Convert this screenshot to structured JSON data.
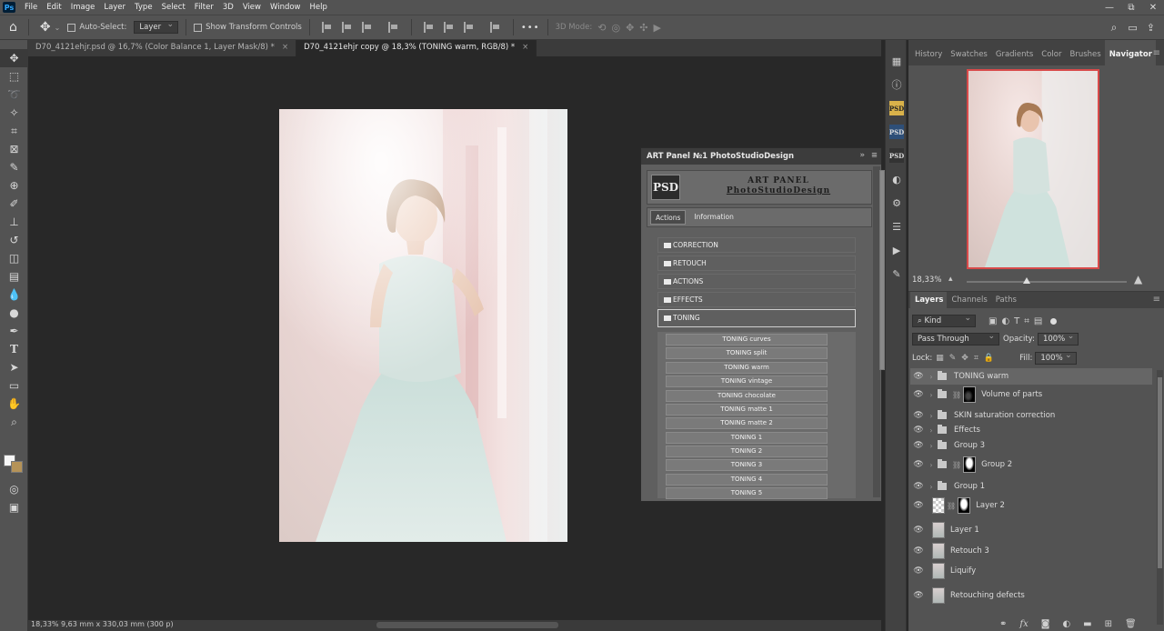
{
  "menubar": {
    "logo": "Ps",
    "items": [
      "File",
      "Edit",
      "Image",
      "Layer",
      "Type",
      "Select",
      "Filter",
      "3D",
      "View",
      "Window",
      "Help"
    ],
    "window_controls": [
      "—",
      "⧉",
      "✕"
    ]
  },
  "options": {
    "auto_select_label": "Auto-Select:",
    "auto_select_value": "Layer",
    "show_transform_label": "Show Transform Controls",
    "mode_3d_label": "3D Mode:",
    "more": "•••"
  },
  "tabs": [
    {
      "label": "D70_4121ehjr.psd @ 16,7% (Color Balance 1, Layer Mask/8) *",
      "active": false
    },
    {
      "label": "D70_4121ehjr copy @ 18,3% (TONING  warm, RGB/8) *",
      "active": true
    }
  ],
  "status": {
    "text": "18,33%  9,63 mm x 330,03 mm (300 p)"
  },
  "art_panel": {
    "title": "ART Panel №1 PhotoStudioDesign",
    "logo": "PSD",
    "brand_line1": "ART PANEL",
    "brand_line2": "PhotoStudioDesign",
    "tabs": [
      "Actions",
      "Information"
    ],
    "folders": [
      "CORRECTION",
      "RETOUCH",
      "ACTIONS",
      "EFFECTS",
      "TONING"
    ],
    "toning_buttons": [
      "TONING curves",
      "TONING split",
      "TONING warm",
      "TONING vintage",
      "TONING chocolate",
      "TONING matte 1",
      "TONING matte 2",
      "TONING 1",
      "TONING 2",
      "TONING 3",
      "TONING 4",
      "TONING 5"
    ]
  },
  "right_icons": [
    "histogram-icon",
    "info-icon",
    "psd-plugin-1",
    "psd-plugin-2",
    "psd-plugin-3",
    "adjust-icon",
    "properties-icon",
    "libraries-icon",
    "play-actions-icon",
    "brush-settings-icon"
  ],
  "navigator": {
    "tabs": [
      "History",
      "Swatches",
      "Gradients",
      "Color",
      "Brushes",
      "Navigator"
    ],
    "active_tab": "Navigator",
    "zoom": "18,33%",
    "zoom_fraction": 0.35
  },
  "layers": {
    "tabs": [
      "Layers",
      "Channels",
      "Paths"
    ],
    "kind_label": "Kind",
    "blend_mode": "Pass Through",
    "opacity_label": "Opacity:",
    "opacity": "100%",
    "lock_label": "Lock:",
    "fill_label": "Fill:",
    "fill": "100%",
    "items": [
      {
        "name": "TONING  warm",
        "type": "group",
        "selected": true
      },
      {
        "name": "Volume of parts",
        "type": "group-mask-dark",
        "selected": false
      },
      {
        "name": "SKIN saturation correction",
        "type": "group",
        "selected": false
      },
      {
        "name": "Effects",
        "type": "group",
        "selected": false
      },
      {
        "name": "Group 3",
        "type": "group",
        "selected": false
      },
      {
        "name": "Group 2",
        "type": "group-mask",
        "selected": false
      },
      {
        "name": "Group 1",
        "type": "group",
        "selected": false
      },
      {
        "name": "Layer 2",
        "type": "pixel-mask",
        "selected": false
      },
      {
        "name": "Layer 1",
        "type": "pixel",
        "selected": false
      },
      {
        "name": "Retouch 3",
        "type": "pixel-caret",
        "selected": false
      },
      {
        "name": "Liquify",
        "type": "pixel",
        "selected": false
      },
      {
        "name": "Retouching defects",
        "type": "pixel",
        "selected": false
      }
    ]
  }
}
